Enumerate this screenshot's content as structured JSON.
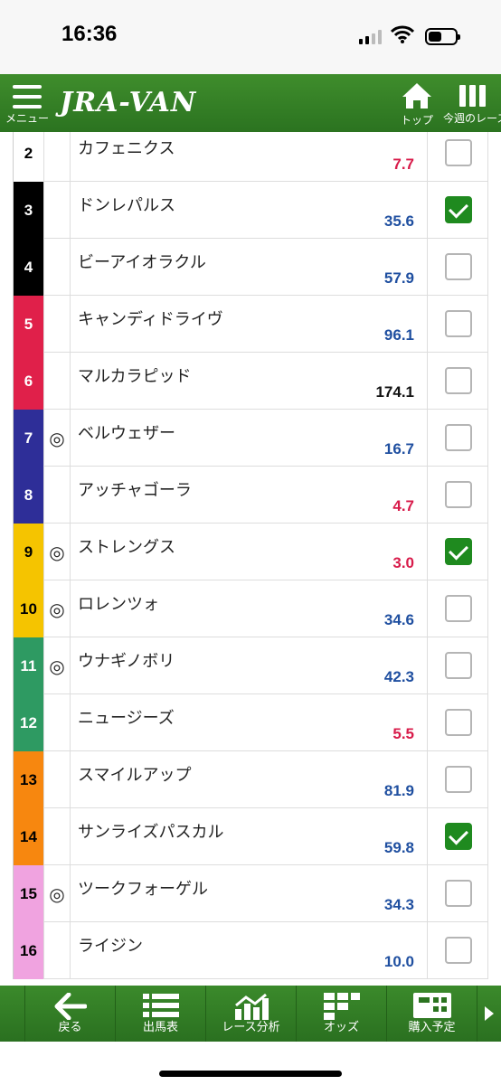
{
  "status": {
    "time": "16:36"
  },
  "header": {
    "menu_label": "メニュー",
    "logo": "JRA-VAN",
    "top_label": "トップ",
    "week_label": "今週のレース"
  },
  "rows": [
    {
      "num": "2",
      "mark": "",
      "name": "カフェニクス",
      "odds": "7.7",
      "odds_color": "#d81b4a",
      "bg": "#ffffff",
      "fg": "#000000",
      "checked": false
    },
    {
      "num": "3",
      "mark": "",
      "name": "ドンレパルス",
      "odds": "35.6",
      "odds_color": "#1f4fa0",
      "bg": "#000000",
      "fg": "#ffffff",
      "checked": true
    },
    {
      "num": "4",
      "mark": "",
      "name": "ビーアイオラクル",
      "odds": "57.9",
      "odds_color": "#1f4fa0",
      "bg": "#000000",
      "fg": "#ffffff",
      "checked": false
    },
    {
      "num": "5",
      "mark": "",
      "name": "キャンディドライヴ",
      "odds": "96.1",
      "odds_color": "#1f4fa0",
      "bg": "#e0204a",
      "fg": "#ffffff",
      "checked": false
    },
    {
      "num": "6",
      "mark": "",
      "name": "マルカラピッド",
      "odds": "174.1",
      "odds_color": "#111111",
      "bg": "#e0204a",
      "fg": "#ffffff",
      "checked": false
    },
    {
      "num": "7",
      "mark": "◎",
      "name": "ベルウェザー",
      "odds": "16.7",
      "odds_color": "#1f4fa0",
      "bg": "#2e2e98",
      "fg": "#ffffff",
      "checked": false
    },
    {
      "num": "8",
      "mark": "",
      "name": "アッチャゴーラ",
      "odds": "4.7",
      "odds_color": "#d81b4a",
      "bg": "#2e2e98",
      "fg": "#ffffff",
      "checked": false
    },
    {
      "num": "9",
      "mark": "◎",
      "name": "ストレングス",
      "odds": "3.0",
      "odds_color": "#d81b4a",
      "bg": "#f5c400",
      "fg": "#000000",
      "checked": true
    },
    {
      "num": "10",
      "mark": "◎",
      "name": "ロレンツォ",
      "odds": "34.6",
      "odds_color": "#1f4fa0",
      "bg": "#f5c400",
      "fg": "#000000",
      "checked": false
    },
    {
      "num": "11",
      "mark": "◎",
      "name": "ウナギノボリ",
      "odds": "42.3",
      "odds_color": "#1f4fa0",
      "bg": "#2e9a62",
      "fg": "#ffffff",
      "checked": false
    },
    {
      "num": "12",
      "mark": "",
      "name": "ニュージーズ",
      "odds": "5.5",
      "odds_color": "#d81b4a",
      "bg": "#2e9a62",
      "fg": "#ffffff",
      "checked": false
    },
    {
      "num": "13",
      "mark": "",
      "name": "スマイルアップ",
      "odds": "81.9",
      "odds_color": "#1f4fa0",
      "bg": "#f7870f",
      "fg": "#000000",
      "checked": false
    },
    {
      "num": "14",
      "mark": "",
      "name": "サンライズパスカル",
      "odds": "59.8",
      "odds_color": "#1f4fa0",
      "bg": "#f7870f",
      "fg": "#000000",
      "checked": true
    },
    {
      "num": "15",
      "mark": "◎",
      "name": "ツークフォーゲル",
      "odds": "34.3",
      "odds_color": "#1f4fa0",
      "bg": "#f0a3e0",
      "fg": "#000000",
      "checked": false
    },
    {
      "num": "16",
      "mark": "",
      "name": "ライジン",
      "odds": "10.0",
      "odds_color": "#1f4fa0",
      "bg": "#f0a3e0",
      "fg": "#000000",
      "checked": false
    }
  ],
  "footer": {
    "back_label": "戻る",
    "entries_label": "出馬表",
    "analysis_label": "レース分析",
    "odds_label": "オッズ",
    "purchase_label": "購入予定"
  },
  "icons": {
    "menu": "hamburger-icon",
    "top": "home-icon",
    "week": "columns-icon",
    "back": "arrow-left-icon",
    "entries": "list-icon",
    "analysis": "chart-icon",
    "odds": "grid-icon",
    "purchase": "ticket-icon",
    "more": "chevron-right-icon"
  }
}
